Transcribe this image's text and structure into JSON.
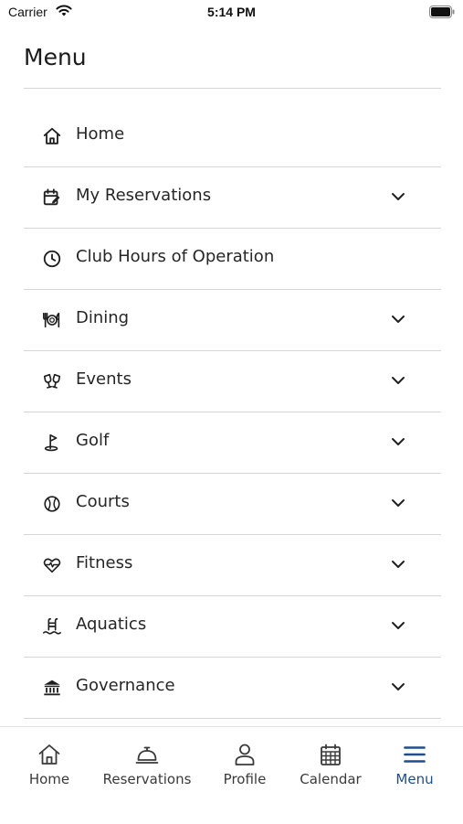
{
  "status_bar": {
    "carrier": "Carrier",
    "time": "5:14 PM"
  },
  "page": {
    "title": "Menu"
  },
  "menu": {
    "items": [
      {
        "label": "Home",
        "icon": "home-icon",
        "expandable": false
      },
      {
        "label": "My Reservations",
        "icon": "calendar-edit-icon",
        "expandable": true
      },
      {
        "label": "Club Hours of Operation",
        "icon": "clock-icon",
        "expandable": false
      },
      {
        "label": "Dining",
        "icon": "dining-icon",
        "expandable": true
      },
      {
        "label": "Events",
        "icon": "cheers-icon",
        "expandable": true
      },
      {
        "label": "Golf",
        "icon": "golf-icon",
        "expandable": true
      },
      {
        "label": "Courts",
        "icon": "tennis-ball-icon",
        "expandable": true
      },
      {
        "label": "Fitness",
        "icon": "heart-pulse-icon",
        "expandable": true
      },
      {
        "label": "Aquatics",
        "icon": "pool-icon",
        "expandable": true
      },
      {
        "label": "Governance",
        "icon": "bank-icon",
        "expandable": true
      }
    ]
  },
  "tabbar": {
    "active": "Menu",
    "active_color": "#1f4e8c",
    "tabs": [
      {
        "label": "Home",
        "icon": "home-icon"
      },
      {
        "label": "Reservations",
        "icon": "service-bell-icon"
      },
      {
        "label": "Profile",
        "icon": "person-icon"
      },
      {
        "label": "Calendar",
        "icon": "calendar-icon"
      },
      {
        "label": "Menu",
        "icon": "hamburger-icon"
      }
    ]
  }
}
